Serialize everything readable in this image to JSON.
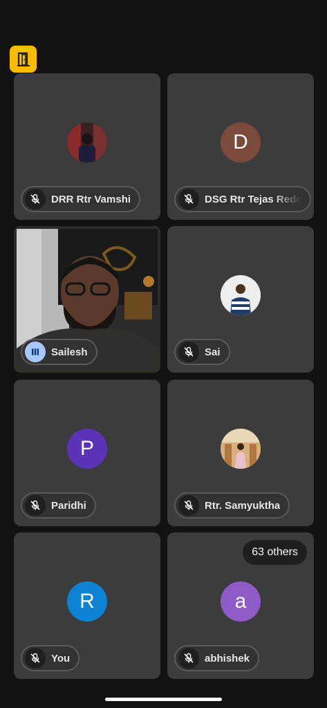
{
  "participants": [
    {
      "name": "DRR Rtr Vamshi",
      "avatar_type": "photo",
      "mic": "muted"
    },
    {
      "name": "DSG Rtr Tejas Reddy",
      "avatar_type": "letter",
      "initial": "D",
      "avatar_color": "#7b4a3a",
      "mic": "muted"
    },
    {
      "name": "Sailesh",
      "avatar_type": "video",
      "mic": "speaking"
    },
    {
      "name": "Sai",
      "avatar_type": "photo",
      "mic": "muted"
    },
    {
      "name": "Paridhi",
      "avatar_type": "letter",
      "initial": "P",
      "avatar_color": "#5b33b6",
      "mic": "muted"
    },
    {
      "name": "Rtr. Samyuktha",
      "avatar_type": "photo",
      "mic": "muted"
    },
    {
      "name": "You",
      "avatar_type": "letter",
      "initial": "R",
      "avatar_color": "#0b82d3",
      "mic": "muted"
    },
    {
      "name": "abhishek",
      "avatar_type": "letter",
      "initial": "a",
      "avatar_color": "#8e5cc8",
      "mic": "muted"
    }
  ],
  "others_label": "63 others",
  "colors": {
    "leave_button": "#fbbc04",
    "active_border": "#a8c7fa",
    "tile_bg": "#3c3c3c"
  }
}
